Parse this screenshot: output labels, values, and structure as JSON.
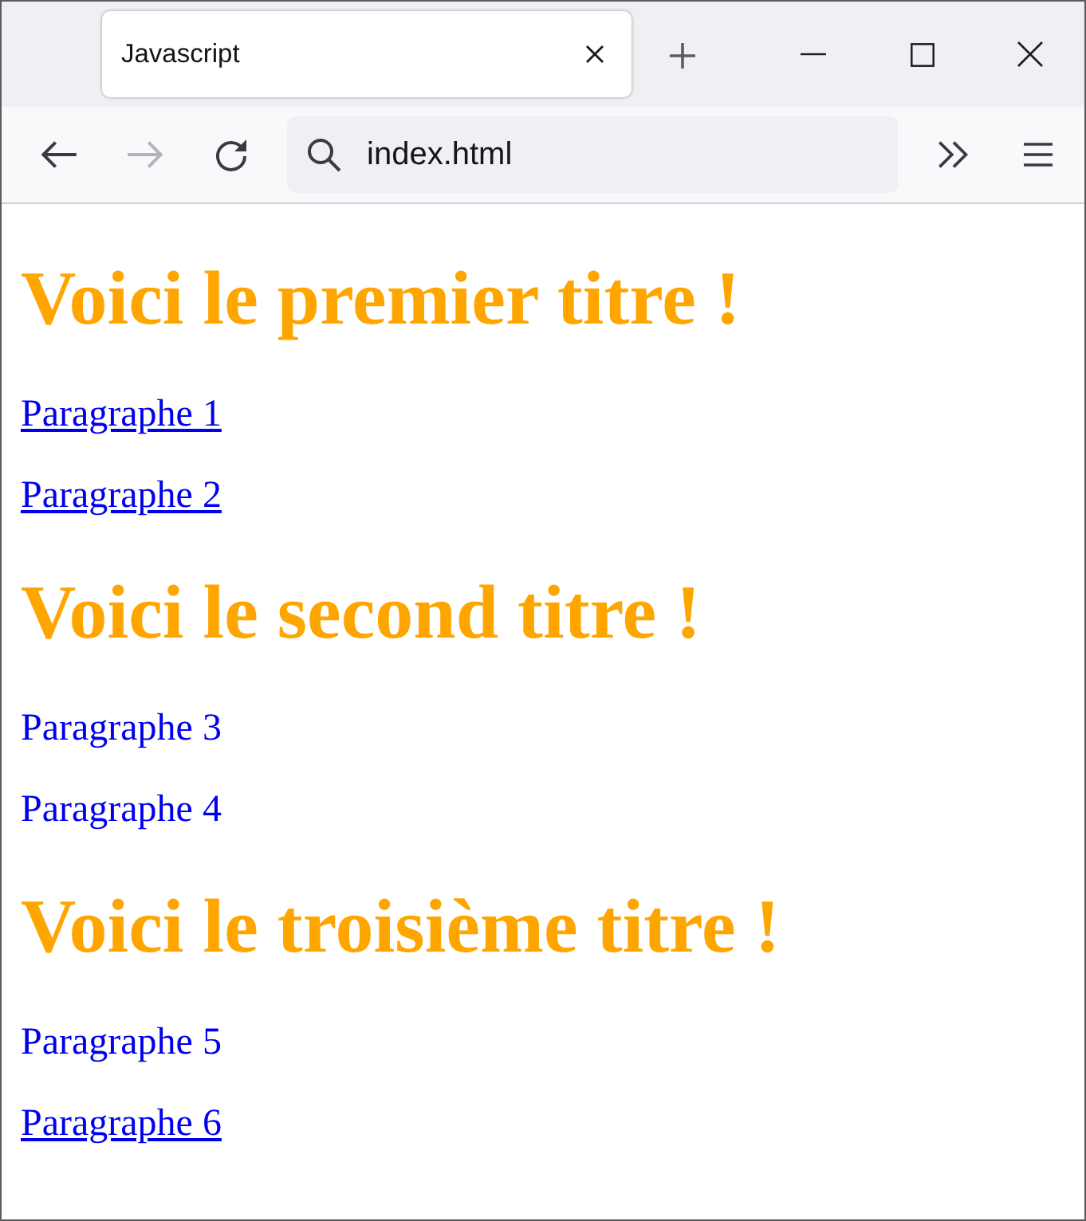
{
  "window": {
    "tab": {
      "title": "Javascript",
      "selected": true
    }
  },
  "toolbar": {
    "back": {
      "disabled": false
    },
    "forward": {
      "disabled": true
    },
    "address": "index.html"
  },
  "content": [
    {
      "kind": "heading",
      "text": "Voici le premier titre !"
    },
    {
      "kind": "paragraph",
      "text": "Paragraphe 1",
      "underlined": true
    },
    {
      "kind": "paragraph",
      "text": "Paragraphe 2",
      "underlined": true
    },
    {
      "kind": "heading",
      "text": "Voici le second titre !"
    },
    {
      "kind": "paragraph",
      "text": "Paragraphe 3",
      "underlined": false
    },
    {
      "kind": "paragraph",
      "text": "Paragraphe 4",
      "underlined": false
    },
    {
      "kind": "heading",
      "text": "Voici le troisième titre !"
    },
    {
      "kind": "paragraph",
      "text": "Paragraphe 5",
      "underlined": false
    },
    {
      "kind": "paragraph",
      "text": "Paragraphe 6",
      "underlined": true
    }
  ]
}
